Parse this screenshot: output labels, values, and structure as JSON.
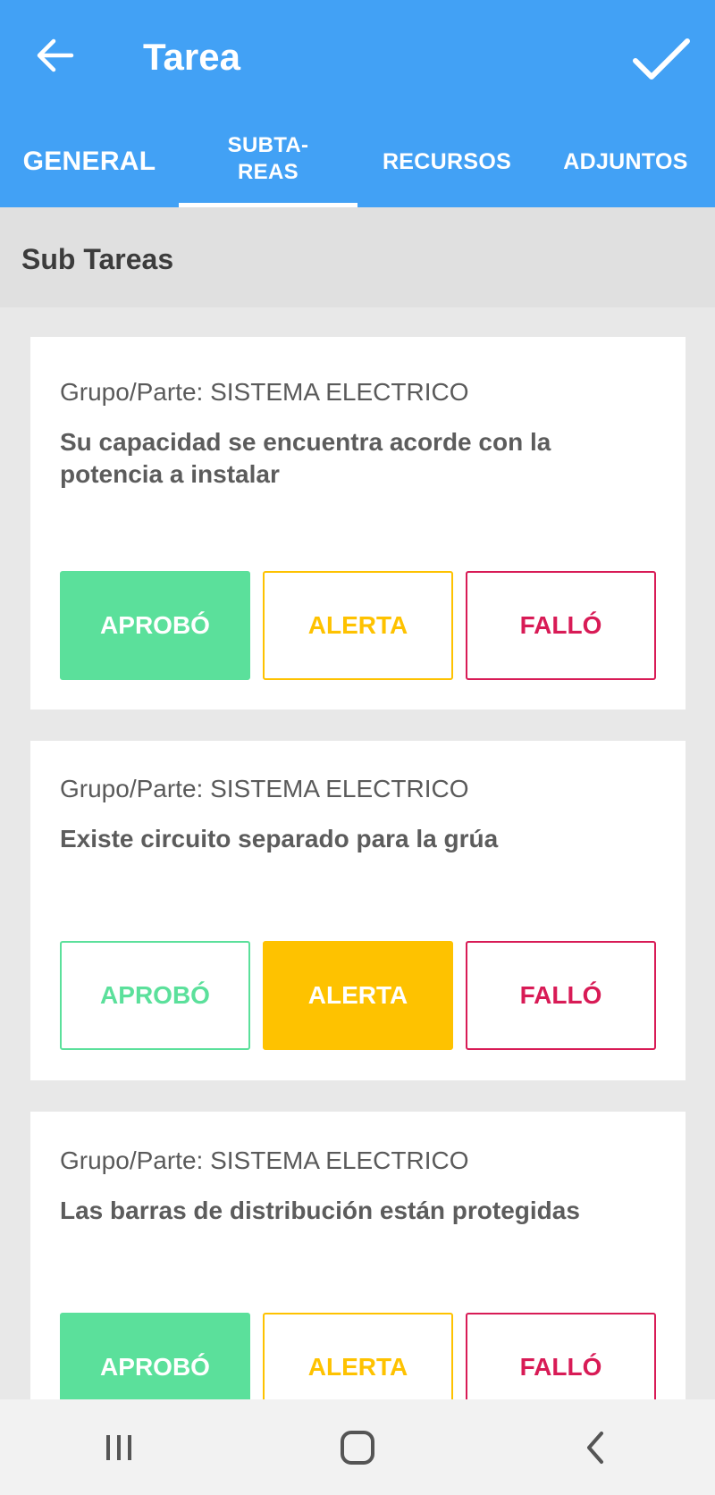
{
  "header": {
    "title": "Tarea"
  },
  "tabs": [
    {
      "label": "GENERAL",
      "active": false
    },
    {
      "label": "SUBTA-\nREAS",
      "active": true
    },
    {
      "label": "RECURSOS",
      "active": false
    },
    {
      "label": "ADJUNTOS",
      "active": false
    }
  ],
  "section": {
    "title": "Sub Tareas"
  },
  "colors": {
    "primary": "#42a1f5",
    "approve": "#5be09b",
    "alert": "#fec200",
    "fail": "#d81b56"
  },
  "subtasks": [
    {
      "group": "Grupo/Parte: SISTEMA ELECTRICO",
      "description": "Su capacidad se encuentra acorde con la potencia a instalar",
      "selected": "approve",
      "buttons": {
        "approve": "APROBÓ",
        "alert": "ALERTA",
        "fail": "FALLÓ"
      }
    },
    {
      "group": "Grupo/Parte: SISTEMA ELECTRICO",
      "description": "Existe circuito separado para la grúa",
      "selected": "alert",
      "buttons": {
        "approve": "APROBÓ",
        "alert": "ALERTA",
        "fail": "FALLÓ"
      }
    },
    {
      "group": "Grupo/Parte: SISTEMA ELECTRICO",
      "description": "Las barras de distribución están protegidas",
      "selected": "approve",
      "buttons": {
        "approve": "APROBÓ",
        "alert": "ALERTA",
        "fail": "FALLÓ"
      }
    }
  ],
  "icons": {
    "back": "arrow-left",
    "done": "check",
    "nav_recents": "recents",
    "nav_home": "home",
    "nav_back": "chevron-left"
  }
}
